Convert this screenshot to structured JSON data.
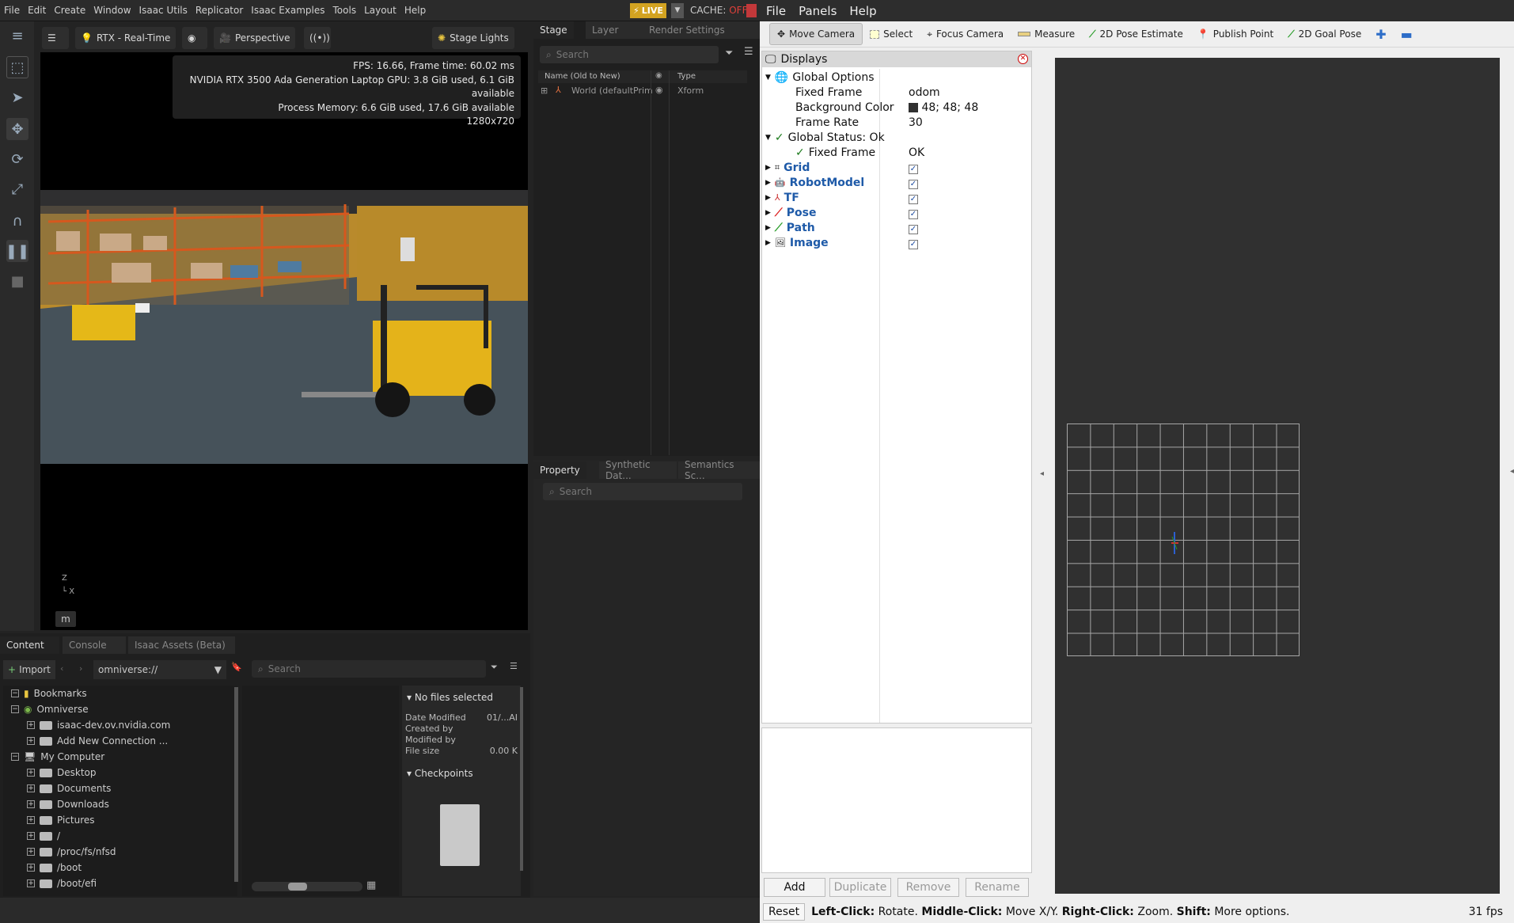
{
  "isaac": {
    "menu": [
      "File",
      "Edit",
      "Create",
      "Window",
      "Isaac Utils",
      "Replicator",
      "Isaac Examples",
      "Tools",
      "Layout",
      "Help"
    ],
    "live": "LIVE",
    "cache_label": "CACHE:",
    "cache_state": "OFF",
    "viewport": {
      "render_mode": "RTX - Real-Time",
      "camera": "Perspective",
      "lights": "Stage Lights",
      "stats": [
        "FPS: 16.66, Frame time: 60.02 ms",
        "NVIDIA RTX 3500 Ada Generation Laptop GPU: 3.8 GiB used, 6.1 GiB available",
        "Process Memory: 6.6 GiB used, 17.6 GiB available",
        "1280x720"
      ],
      "axis_z": "Z",
      "axis_x": "X",
      "m_label": "m"
    },
    "stage": {
      "tabs": [
        "Stage",
        "Layer",
        "Render Settings"
      ],
      "search_placeholder": "Search",
      "col_name": "Name (Old to New)",
      "col_type": "Type",
      "row_name": "World (defaultPrim",
      "row_type": "Xform"
    },
    "property": {
      "tabs": [
        "Property",
        "Synthetic Dat...",
        "Semantics Sc..."
      ],
      "search_placeholder": "Search"
    },
    "content": {
      "tabs": [
        "Content",
        "Console",
        "Isaac Assets (Beta)"
      ],
      "import": "Import",
      "path": "omniverse://",
      "search_placeholder": "Search",
      "tree": [
        "Bookmarks",
        "Omniverse",
        "isaac-dev.ov.nvidia.com",
        "Add New Connection ...",
        "My Computer",
        "Desktop",
        "Documents",
        "Downloads",
        "Pictures",
        "/",
        "/proc/fs/nfsd",
        "/boot",
        "/boot/efi"
      ],
      "info_title": "No files selected",
      "date_modified_label": "Date Modified",
      "date_modified_val": "01/...AI",
      "created_by": "Created by",
      "modified_by": "Modified by",
      "file_size_label": "File size",
      "file_size_val": "0.00 K",
      "checkpoints": "Checkpoints"
    }
  },
  "rviz": {
    "menu": [
      "File",
      "Panels",
      "Help"
    ],
    "tools": [
      "Move Camera",
      "Select",
      "Focus Camera",
      "Measure",
      "2D Pose Estimate",
      "Publish Point",
      "2D Goal Pose"
    ],
    "displays_title": "Displays",
    "global_options": "Global Options",
    "fixed_frame_label": "Fixed Frame",
    "fixed_frame_val": "odom",
    "bg_color_label": "Background Color",
    "bg_color_val": "48; 48; 48",
    "frame_rate_label": "Frame Rate",
    "frame_rate_val": "30",
    "global_status": "Global Status: Ok",
    "status_fixed_frame": "Fixed Frame",
    "status_ok": "OK",
    "display_items": [
      "Grid",
      "RobotModel",
      "TF",
      "Pose",
      "Path",
      "Image"
    ],
    "buttons": [
      "Add",
      "Duplicate",
      "Remove",
      "Rename"
    ],
    "reset": "Reset",
    "hint_left": "Left-Click:",
    "hint_left_t": "Rotate.",
    "hint_mid": "Middle-Click:",
    "hint_mid_t": "Move X/Y.",
    "hint_right": "Right-Click:",
    "hint_right_t": "Zoom.",
    "hint_shift": "Shift:",
    "hint_shift_t": "More options.",
    "fps": "31 fps",
    "colors": {
      "bg": "#303030",
      "accent": "#1e5aa8"
    }
  }
}
